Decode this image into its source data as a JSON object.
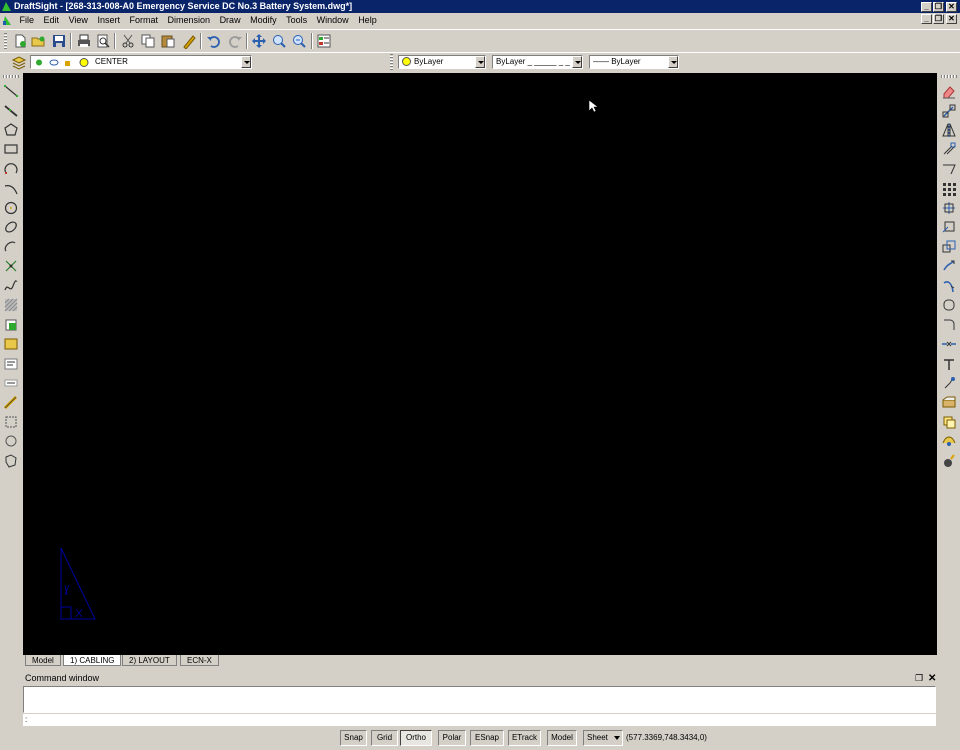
{
  "window": {
    "title": "DraftSight - [268-313-008-A0 Emergency Service DC No.3 Battery System.dwg*]",
    "controls": [
      "_",
      "❐",
      "✕"
    ]
  },
  "menu": {
    "items": [
      "File",
      "Edit",
      "View",
      "Insert",
      "Format",
      "Dimension",
      "Draw",
      "Modify",
      "Tools",
      "Window",
      "Help"
    ],
    "mdi_controls": [
      "_",
      "❐",
      "✕"
    ]
  },
  "layers": {
    "current_layer": "CENTER",
    "color": "ByLayer",
    "linetype": "ByLayer _ _____ _ _",
    "lineweight": "—— ByLayer"
  },
  "tabs": [
    "Model",
    "1) CABLING",
    "2) LAYOUT",
    "ECN-X"
  ],
  "active_tab": "1) CABLING",
  "command_window": {
    "title": "Command window",
    "prompt": ":",
    "history": ""
  },
  "status": {
    "toggles": [
      "Snap",
      "Grid",
      "Ortho",
      "Polar",
      "ESnap",
      "ETrack"
    ],
    "active_toggles": [
      "Ortho"
    ],
    "space_model": "Model",
    "space_sheet": "Sheet",
    "coordinates": "(577.3369,748.3434,0)"
  },
  "colors": {
    "titlebar": "#0a246a",
    "canvas": "#000000",
    "chrome": "#d4d0c8",
    "ucs_icon": "#0000a0"
  }
}
